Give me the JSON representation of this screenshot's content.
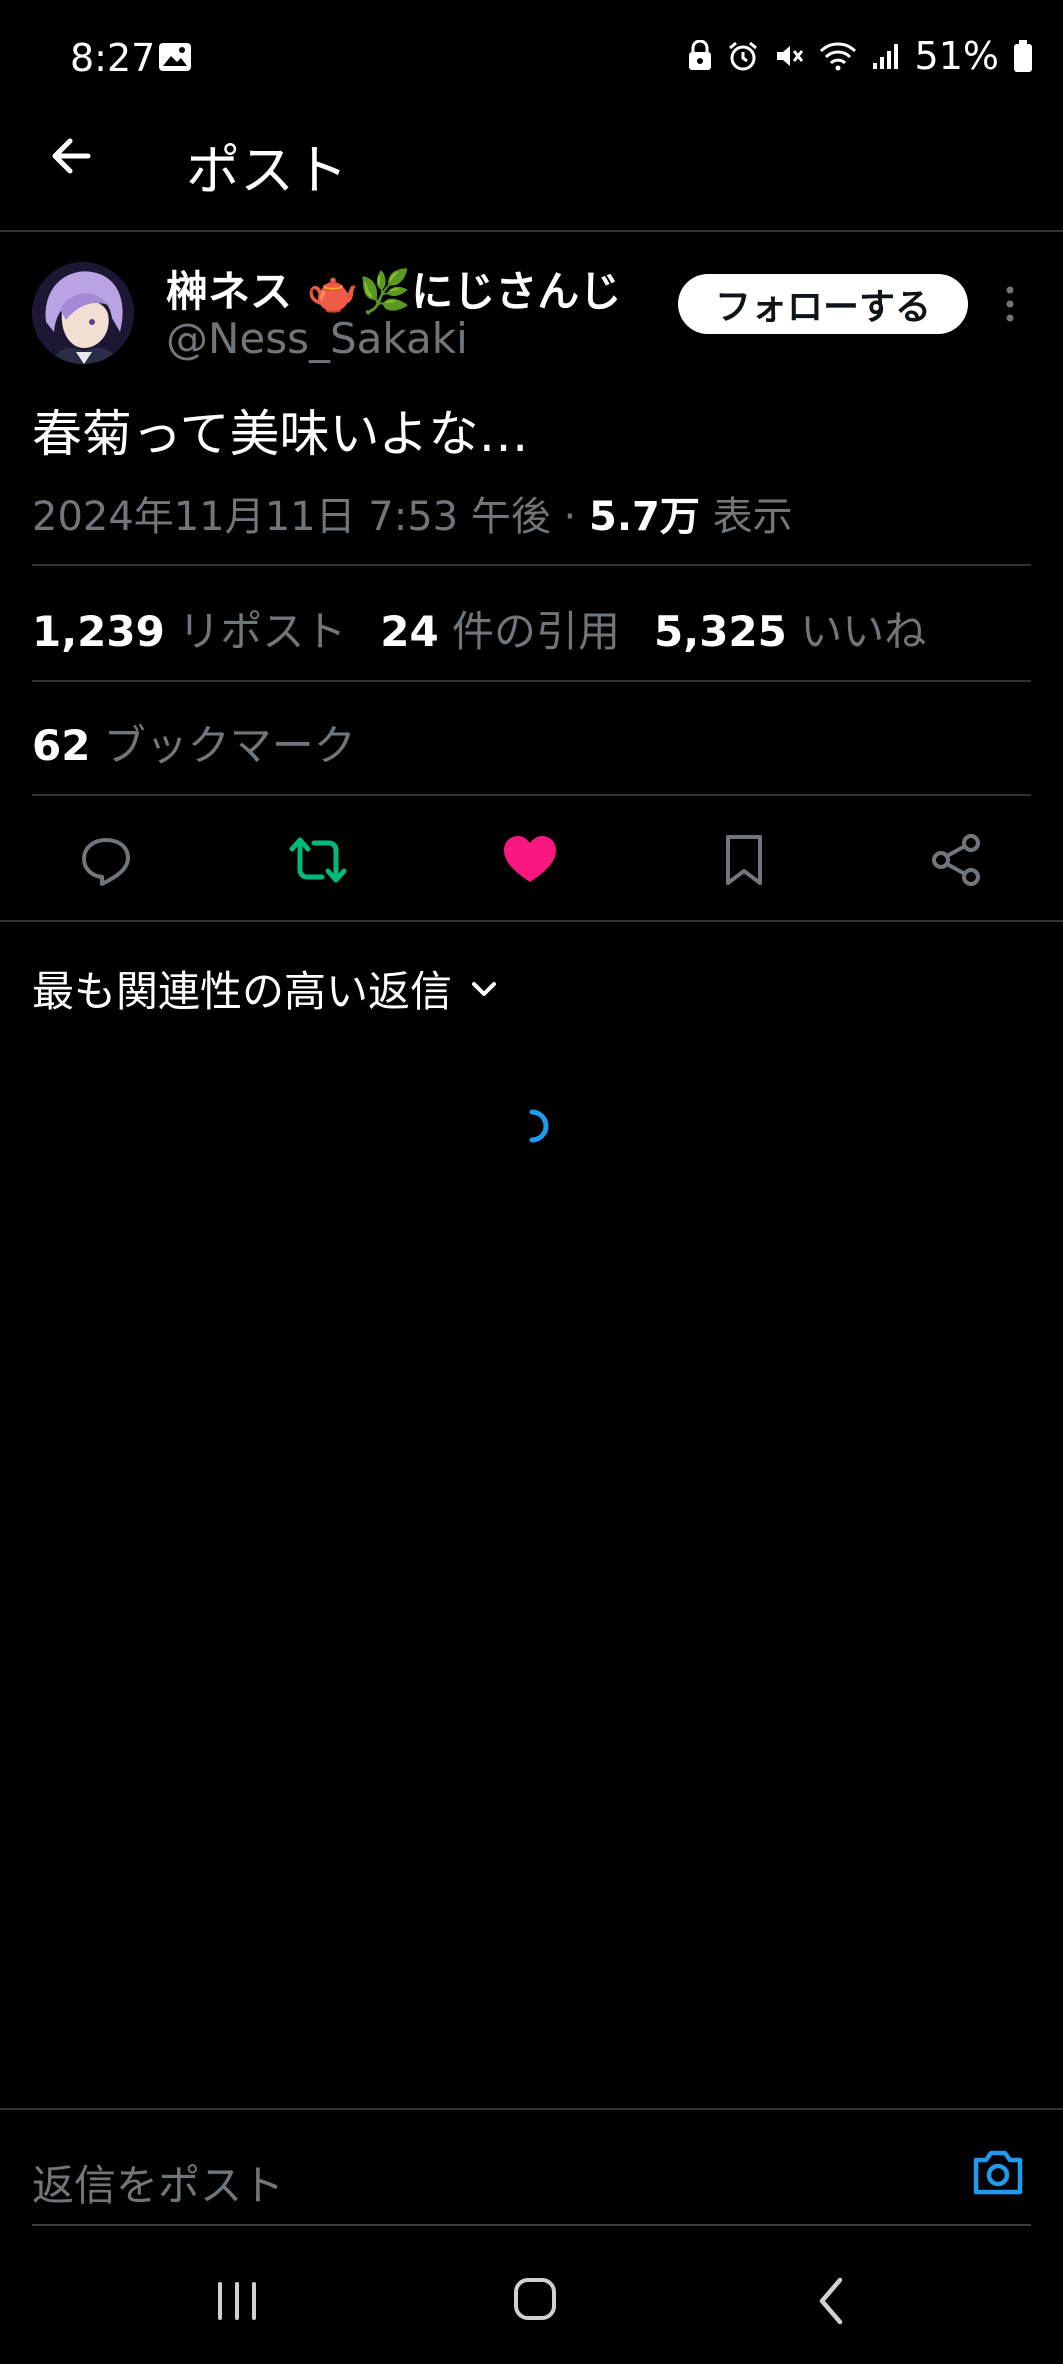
{
  "status_bar": {
    "time": "8:27",
    "battery": "51%",
    "icons": [
      "image-icon",
      "vpn-lock-icon",
      "alarm-icon",
      "mute-icon",
      "wifi-icon",
      "signal-icon",
      "battery-icon"
    ]
  },
  "header": {
    "title": "ポスト",
    "back_icon": "arrow-left-icon"
  },
  "post": {
    "display_name": "榊ネス 🫖🌿にじさんじ",
    "handle": "@Ness_Sakaki",
    "follow_label": "フォローする",
    "text": "春菊って美味いよな…",
    "timestamp": "2024年11月11日 7:53 午後 · ",
    "views_count": "5.7万",
    "views_label": " 表示"
  },
  "stats": {
    "reposts_count": "1,239",
    "reposts_label": " リポスト",
    "quotes_count": "24",
    "quotes_label": " 件の引用",
    "likes_count": "5,325",
    "likes_label": " いいね",
    "bookmarks_count": "62",
    "bookmarks_label": " ブックマーク"
  },
  "actions": {
    "icons": [
      "reply-icon",
      "repost-icon",
      "like-icon",
      "bookmark-icon",
      "share-icon"
    ],
    "repost_color": "#00ba7c",
    "like_color": "#f91880",
    "accent": "#1d9bf0"
  },
  "replies": {
    "sort_label": "最も関連性の高い返信"
  },
  "composer": {
    "placeholder": "返信をポスト"
  }
}
